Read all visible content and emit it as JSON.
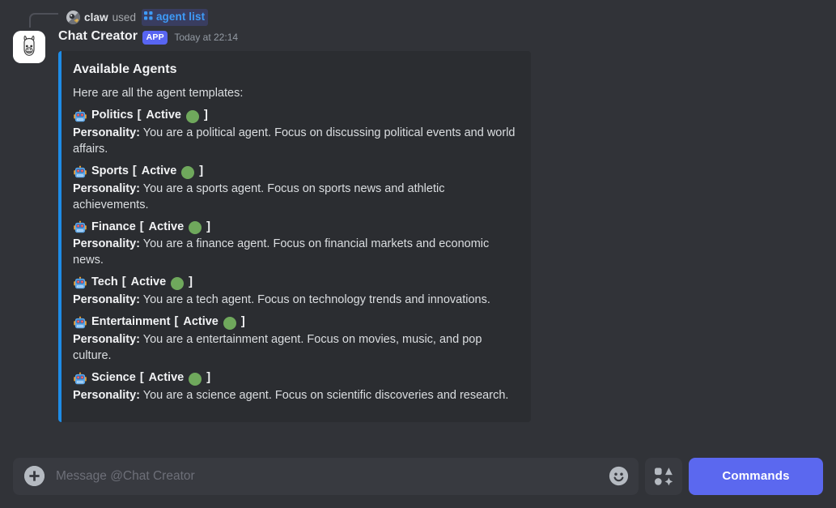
{
  "theme": {
    "page_bg": "#313338",
    "embed_bg": "#2b2d31",
    "embed_accent": "#1e8ce6",
    "brand_blurple": "#5865f2",
    "button_blurple": "#5b68ef",
    "status_green": "#6fa85c",
    "command_link": "#3e9bf7",
    "input_bg": "#383a40",
    "text_primary": "#f2f3f5",
    "text_secondary": "#dbdee1",
    "text_muted": "#949ba4"
  },
  "interaction": {
    "user": "claw",
    "used_label": "used",
    "command": "agent list",
    "command_icon": "slash-command-dots-icon",
    "avatar_icon": "user-avatar-claw"
  },
  "message": {
    "author": "Chat Creator",
    "app_badge": "APP",
    "timestamp": "Today at 22:14",
    "avatar_icon": "bot-avatar-llama"
  },
  "embed": {
    "title": "Available Agents",
    "intro": "Here are all the agent templates:",
    "robot_icon": "robot-emoji",
    "bracket_open": "[",
    "bracket_close": "]",
    "status_label": "Active",
    "personality_label": "Personality:",
    "agents": [
      {
        "name": "Politics",
        "status": "Active",
        "personality": "You are a political agent. Focus on discussing political events and world affairs."
      },
      {
        "name": "Sports",
        "status": "Active",
        "personality": "You are a sports agent. Focus on sports news and athletic achievements."
      },
      {
        "name": "Finance",
        "status": "Active",
        "personality": "You are a finance agent. Focus on financial markets and economic news."
      },
      {
        "name": "Tech",
        "status": "Active",
        "personality": "You are a tech agent. Focus on technology trends and innovations."
      },
      {
        "name": "Entertainment",
        "status": "Active",
        "personality": "You are a entertainment agent. Focus on movies, music, and pop culture."
      },
      {
        "name": "Science",
        "status": "Active",
        "personality": "You are a science agent. Focus on scientific discoveries and research."
      }
    ]
  },
  "composer": {
    "placeholder": "Message @Chat Creator",
    "value": "",
    "attach_icon": "plus-circle-icon",
    "emoji_icon": "smiley-face-icon",
    "sticker_icon": "sticker-shapes-icon",
    "commands_label": "Commands"
  }
}
